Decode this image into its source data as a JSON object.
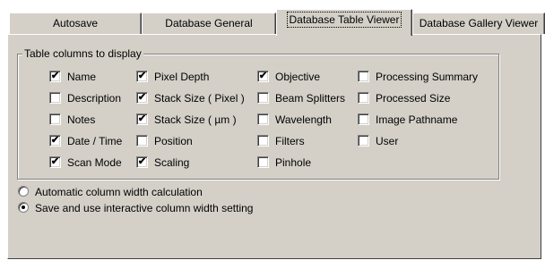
{
  "tabs": [
    {
      "label": "Autosave",
      "active": false
    },
    {
      "label": "Database General",
      "active": false
    },
    {
      "label": "Database Table Viewer",
      "active": true
    },
    {
      "label": "Database Gallery Viewer",
      "active": false
    }
  ],
  "group": {
    "title": "Table columns to display",
    "columns": [
      [
        {
          "label": "Name",
          "checked": true
        },
        {
          "label": "Description",
          "checked": false
        },
        {
          "label": "Notes",
          "checked": false
        },
        {
          "label": "Date / Time",
          "checked": true
        },
        {
          "label": "Scan Mode",
          "checked": true
        }
      ],
      [
        {
          "label": "Pixel Depth",
          "checked": true
        },
        {
          "label": "Stack Size ( Pixel )",
          "checked": true
        },
        {
          "label": "Stack Size ( µm )",
          "checked": true
        },
        {
          "label": "Position",
          "checked": false
        },
        {
          "label": "Scaling",
          "checked": true
        }
      ],
      [
        {
          "label": "Objective",
          "checked": true
        },
        {
          "label": "Beam Splitters",
          "checked": false
        },
        {
          "label": "Wavelength",
          "checked": false
        },
        {
          "label": "Filters",
          "checked": false
        },
        {
          "label": "Pinhole",
          "checked": false
        }
      ],
      [
        {
          "label": "Processing Summary",
          "checked": false
        },
        {
          "label": "Processed Size",
          "checked": false
        },
        {
          "label": "Image Pathname",
          "checked": false
        },
        {
          "label": "User",
          "checked": false
        }
      ]
    ]
  },
  "width_options": [
    {
      "label": "Automatic column width calculation",
      "selected": false
    },
    {
      "label": "Save and use interactive column width setting",
      "selected": true
    }
  ],
  "colors": {
    "face": "#d4d0c8",
    "shadow": "#808080",
    "highlight": "#ffffff"
  }
}
